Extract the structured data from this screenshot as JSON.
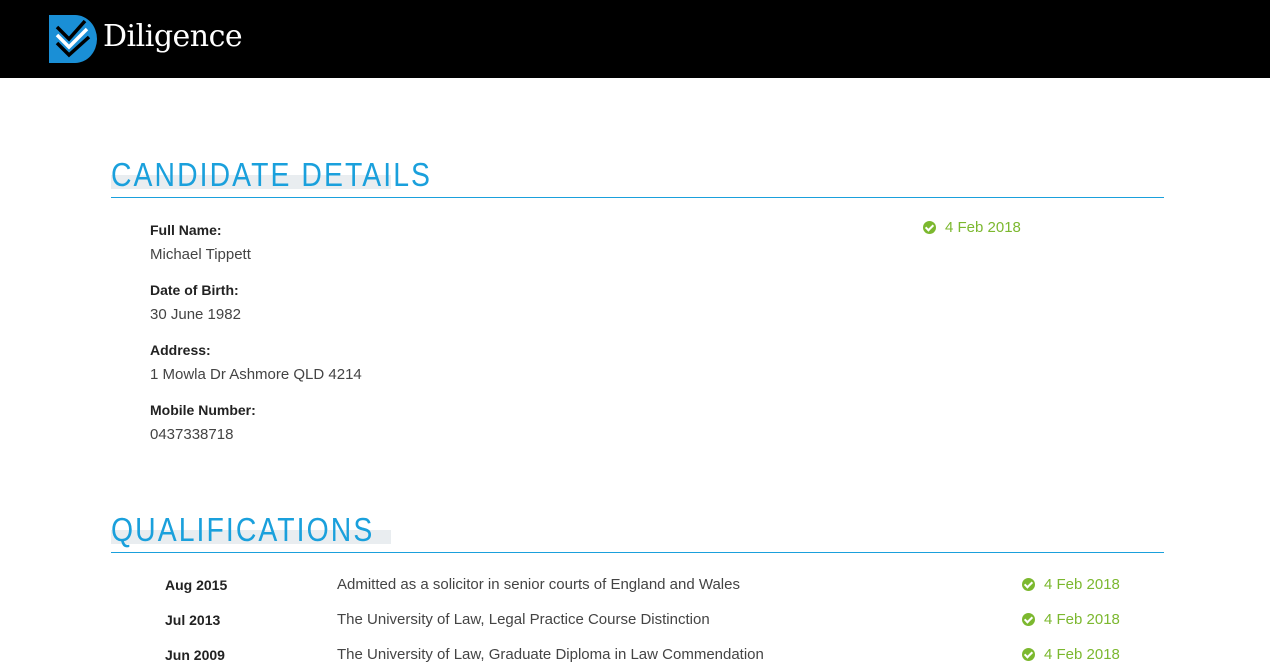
{
  "header": {
    "brand": "Diligence",
    "logo_icon": "diligence-chevron-logo"
  },
  "candidate": {
    "section_title": "CANDIDATE DETAILS",
    "verified_date": "4 Feb 2018",
    "fields": [
      {
        "label": "Full Name:",
        "value": "Michael Tippett"
      },
      {
        "label": "Date of Birth:",
        "value": "30 June 1982"
      },
      {
        "label": "Address:",
        "value": "1 Mowla Dr Ashmore QLD 4214"
      },
      {
        "label": "Mobile Number:",
        "value": "0437338718"
      }
    ]
  },
  "qualifications": {
    "section_title": "QUALIFICATIONS",
    "items": [
      {
        "date": "Aug 2015",
        "description": "Admitted as a solicitor in senior courts of England and Wales",
        "verified": "4 Feb 2018"
      },
      {
        "date": "Jul 2013",
        "description": "The University of Law, Legal Practice Course Distinction",
        "verified": "4 Feb 2018"
      },
      {
        "date": "Jun 2009",
        "description": "The University of Law, Graduate Diploma in Law Commendation",
        "verified": "4 Feb 2018"
      }
    ]
  },
  "colors": {
    "accent_blue": "#1aa0dc",
    "verified_green": "#7cb82f",
    "header_bg": "#000000"
  }
}
